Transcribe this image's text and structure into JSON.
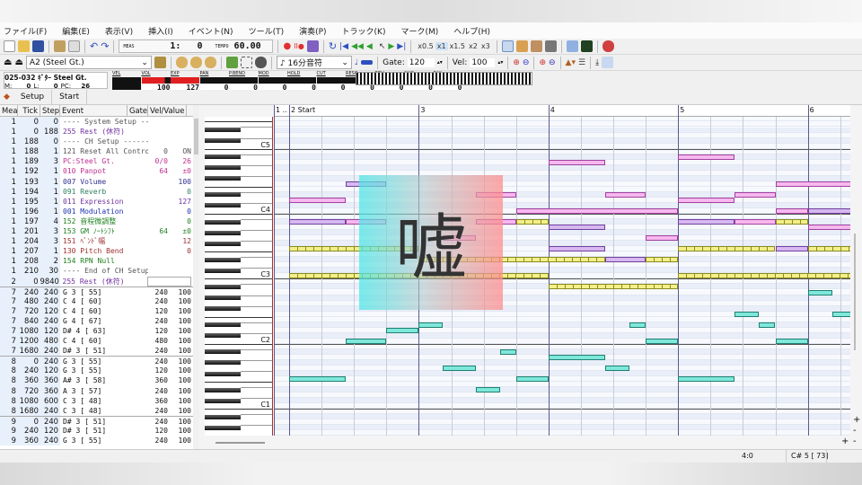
{
  "menu": [
    "ファイル(F)",
    "編集(E)",
    "表示(V)",
    "挿入(I)",
    "イベント(N)",
    "ツール(T)",
    "演奏(P)",
    "トラック(K)",
    "マーク(M)",
    "ヘルプ(H)"
  ],
  "toolbar": {
    "meas_label": "MEAS",
    "meas_value": "1:   0",
    "tempo_label": "TEMPO",
    "tempo_value": "60.00",
    "speeds": [
      "x0.5",
      "x1",
      "x1.5",
      "x2",
      "x3"
    ],
    "active_speed": "x1"
  },
  "toolbar2": {
    "instrument": "A2 (Steel Gt.)",
    "note_length": "16分音符",
    "gate_label": "Gate:",
    "gate_value": "120",
    "vel_label": "Vel:",
    "vel_value": "100"
  },
  "track_info": {
    "name": "025-032 ｷﾞﾀｰ Steel Gt.",
    "m_label": "M:",
    "m_value": "0",
    "l_label": "L:",
    "l_value": "0",
    "pc_label": "PC:",
    "pc_value": "26"
  },
  "meters": [
    {
      "label": "VEL",
      "value": "",
      "level": 0
    },
    {
      "label": "VOL",
      "value": "100",
      "level": 0.79
    },
    {
      "label": "EXP",
      "value": "127",
      "level": 1
    },
    {
      "label": "PAN",
      "value": "0",
      "level": 0
    },
    {
      "label": "P.BEND",
      "value": "0",
      "level": 0
    },
    {
      "label": "MOD",
      "value": "0",
      "level": 0
    },
    {
      "label": "HOLD",
      "value": "0",
      "level": 0
    },
    {
      "label": "CUT",
      "value": "0",
      "level": 0
    },
    {
      "label": "RESO",
      "value": "0",
      "level": 0
    },
    {
      "label": "REV",
      "value": "0",
      "level": 0
    },
    {
      "label": "CHO",
      "value": "0",
      "level": 0
    },
    {
      "label": "DLY",
      "value": "0",
      "level": 0
    }
  ],
  "tabs": [
    "Setup",
    "Start"
  ],
  "list": {
    "headers": [
      "Mea",
      "Tick",
      "Step",
      "Event",
      "Gate",
      "Vel/Value"
    ],
    "rows": [
      [
        "1",
        "0",
        "0",
        "---- System Setup -------------",
        "",
        "",
        "#555"
      ],
      [
        "1",
        "0",
        "188",
        "255 Rest (休符)",
        "",
        "",
        "#7030a0"
      ],
      [
        "1",
        "188",
        "0",
        "---- CH Setup -----------------",
        "",
        "",
        "#555"
      ],
      [
        "1",
        "188",
        "1",
        "121 Reset All Control",
        "0",
        "ON",
        "#555"
      ],
      [
        "1",
        "189",
        "3",
        "PC:Steel Gt.",
        "0/0",
        "26",
        "#c03090"
      ],
      [
        "1",
        "192",
        "1",
        "010 Panpot",
        "64",
        "±0",
        "#c03090"
      ],
      [
        "1",
        "193",
        "1",
        "007 Volume",
        "",
        "100",
        "#303090"
      ],
      [
        "1",
        "194",
        "1",
        "091 Reverb",
        "",
        "0",
        "#308060"
      ],
      [
        "1",
        "195",
        "1",
        "011 Expression",
        "",
        "127",
        "#7030a0"
      ],
      [
        "1",
        "196",
        "1",
        "001 Modulation",
        "",
        "0",
        "#2030b0"
      ],
      [
        "1",
        "197",
        "4",
        "152 音程微調整",
        "",
        "0",
        "#208020"
      ],
      [
        "1",
        "201",
        "3",
        "153 GM ﾉｰﾄｼﾌﾄ",
        "64",
        "±0",
        "#208020"
      ],
      [
        "1",
        "204",
        "3",
        "151 ﾍﾞﾝﾄﾞ幅",
        "",
        "12",
        "#a03030"
      ],
      [
        "1",
        "207",
        "1",
        "130 Pitch Bend",
        "",
        "0",
        "#a03030"
      ],
      [
        "1",
        "208",
        "2",
        "154 RPN Null",
        "",
        "",
        "#208020"
      ],
      [
        "1",
        "210",
        "30",
        "---- End of CH Setup ----------",
        "",
        "",
        "#555"
      ],
      [
        "2",
        "0",
        "9840",
        "255 Rest (休符)",
        "",
        "",
        "#7030a0"
      ],
      [
        "7",
        "240",
        "240",
        "G  3 [ 55]",
        "240",
        "100",
        "#111"
      ],
      [
        "7",
        "480",
        "240",
        "C  4 [ 60]",
        "240",
        "100",
        "#111"
      ],
      [
        "7",
        "720",
        "120",
        "C  4 [ 60]",
        "120",
        "100",
        "#111"
      ],
      [
        "7",
        "840",
        "240",
        "G  4 [ 67]",
        "240",
        "100",
        "#111"
      ],
      [
        "7",
        "1080",
        "120",
        "D# 4 [ 63]",
        "120",
        "100",
        "#111"
      ],
      [
        "7",
        "1200",
        "480",
        "C  4 [ 60]",
        "480",
        "100",
        "#111"
      ],
      [
        "7",
        "1680",
        "240",
        "D# 3 [ 51]",
        "240",
        "100",
        "#111"
      ],
      [
        "8",
        "0",
        "240",
        "G  3 [ 55]",
        "240",
        "100",
        "#111"
      ],
      [
        "8",
        "240",
        "120",
        "G  3 [ 55]",
        "120",
        "100",
        "#111"
      ],
      [
        "8",
        "360",
        "360",
        "A# 3 [ 58]",
        "360",
        "100",
        "#111"
      ],
      [
        "8",
        "720",
        "360",
        "A  3 [ 57]",
        "240",
        "100",
        "#111"
      ],
      [
        "8",
        "1080",
        "600",
        "C  3 [ 48]",
        "360",
        "100",
        "#111"
      ],
      [
        "8",
        "1680",
        "240",
        "C  3 [ 48]",
        "240",
        "100",
        "#111"
      ],
      [
        "9",
        "0",
        "240",
        "D# 3 [ 51]",
        "240",
        "100",
        "#111"
      ],
      [
        "9",
        "240",
        "120",
        "D# 3 [ 51]",
        "120",
        "100",
        "#111"
      ],
      [
        "9",
        "360",
        "240",
        "G  3 [ 55]",
        "240",
        "100",
        "#111"
      ]
    ]
  },
  "roll": {
    "measure_labels": [
      "1 ..",
      "2 Start",
      "3",
      "4",
      "5",
      "6"
    ],
    "octave_labels": [
      "C5",
      "C4",
      "C3",
      "C2",
      "C1"
    ],
    "colors": {
      "pink": "#f7b8ee",
      "lavender": "#d7b8f0",
      "yellow": "#f3f08a",
      "cyan": "#7fe8dc"
    },
    "notes_format": "measure, beat, length_beats, midi_pitch, color",
    "notes": [
      [
        4,
        0,
        1.75,
        69,
        "pink"
      ],
      [
        5,
        0,
        1.75,
        70,
        "pink"
      ],
      [
        5,
        3,
        2.5,
        65,
        "pink"
      ],
      [
        2,
        1.75,
        1.25,
        65,
        "lavender"
      ],
      [
        3,
        1.75,
        1.25,
        63,
        "pink"
      ],
      [
        4,
        1.75,
        1.25,
        63,
        "pink"
      ],
      [
        5,
        1.75,
        1.25,
        63,
        "pink"
      ],
      [
        2,
        0,
        1.75,
        62,
        "pink"
      ],
      [
        5,
        0,
        1.75,
        62,
        "pink"
      ],
      [
        3,
        3,
        5,
        60,
        "pink"
      ],
      [
        5,
        3,
        1,
        60,
        "pink"
      ],
      [
        6,
        0,
        1.5,
        60,
        "lavender"
      ],
      [
        2,
        0,
        1.75,
        58,
        "lavender"
      ],
      [
        2,
        1.75,
        1.25,
        58,
        "pink"
      ],
      [
        3,
        1.75,
        1.25,
        58,
        "pink"
      ],
      [
        5,
        0,
        1.75,
        58,
        "lavender"
      ],
      [
        5,
        1.75,
        1.25,
        58,
        "pink"
      ],
      [
        3,
        3,
        1,
        58,
        "yellow"
      ],
      [
        5,
        3,
        1,
        58,
        "yellow"
      ],
      [
        4,
        0,
        1.75,
        57,
        "lavender"
      ],
      [
        6,
        0,
        1.5,
        57,
        "pink"
      ],
      [
        4,
        3,
        1,
        55,
        "pink"
      ],
      [
        3,
        0.75,
        1,
        55,
        "pink"
      ],
      [
        2,
        0,
        4,
        53,
        "yellow"
      ],
      [
        5,
        0,
        3,
        53,
        "yellow"
      ],
      [
        4,
        0,
        1.75,
        53,
        "lavender"
      ],
      [
        5,
        3,
        1,
        53,
        "lavender"
      ],
      [
        6,
        0,
        1.5,
        53,
        "yellow"
      ],
      [
        3,
        0,
        5.75,
        51,
        "yellow"
      ],
      [
        4,
        1.75,
        1.25,
        51,
        "lavender"
      ],
      [
        4,
        3,
        1,
        51,
        "yellow"
      ],
      [
        2,
        0,
        8,
        48,
        "yellow"
      ],
      [
        5,
        0,
        5.5,
        48,
        "yellow"
      ],
      [
        4,
        0,
        4,
        46,
        "yellow"
      ],
      [
        6,
        0,
        0.75,
        45,
        "cyan"
      ],
      [
        5,
        1.75,
        0.75,
        41,
        "cyan"
      ],
      [
        6,
        0.75,
        0.75,
        41,
        "cyan"
      ],
      [
        3,
        0,
        0.75,
        39,
        "cyan"
      ],
      [
        4,
        2.5,
        0.5,
        39,
        "cyan"
      ],
      [
        5,
        2.5,
        0.5,
        39,
        "cyan"
      ],
      [
        2,
        3,
        1,
        38,
        "cyan"
      ],
      [
        2,
        1.75,
        1.25,
        36,
        "cyan"
      ],
      [
        4,
        3,
        1,
        36,
        "cyan"
      ],
      [
        5,
        3,
        1,
        36,
        "cyan"
      ],
      [
        3,
        2.5,
        0.5,
        34,
        "cyan"
      ],
      [
        4,
        0,
        1.75,
        33,
        "cyan"
      ],
      [
        3,
        0.75,
        1,
        31,
        "cyan"
      ],
      [
        4,
        1.75,
        0.75,
        31,
        "cyan"
      ],
      [
        2,
        0,
        1.75,
        29,
        "cyan"
      ],
      [
        3,
        3,
        1,
        29,
        "cyan"
      ],
      [
        5,
        0,
        1.75,
        29,
        "cyan"
      ],
      [
        3,
        1.75,
        0.75,
        27,
        "cyan"
      ]
    ]
  },
  "overlay_text": "嘘",
  "status": {
    "position": "4:0",
    "note": "C# 5 [ 73]"
  }
}
